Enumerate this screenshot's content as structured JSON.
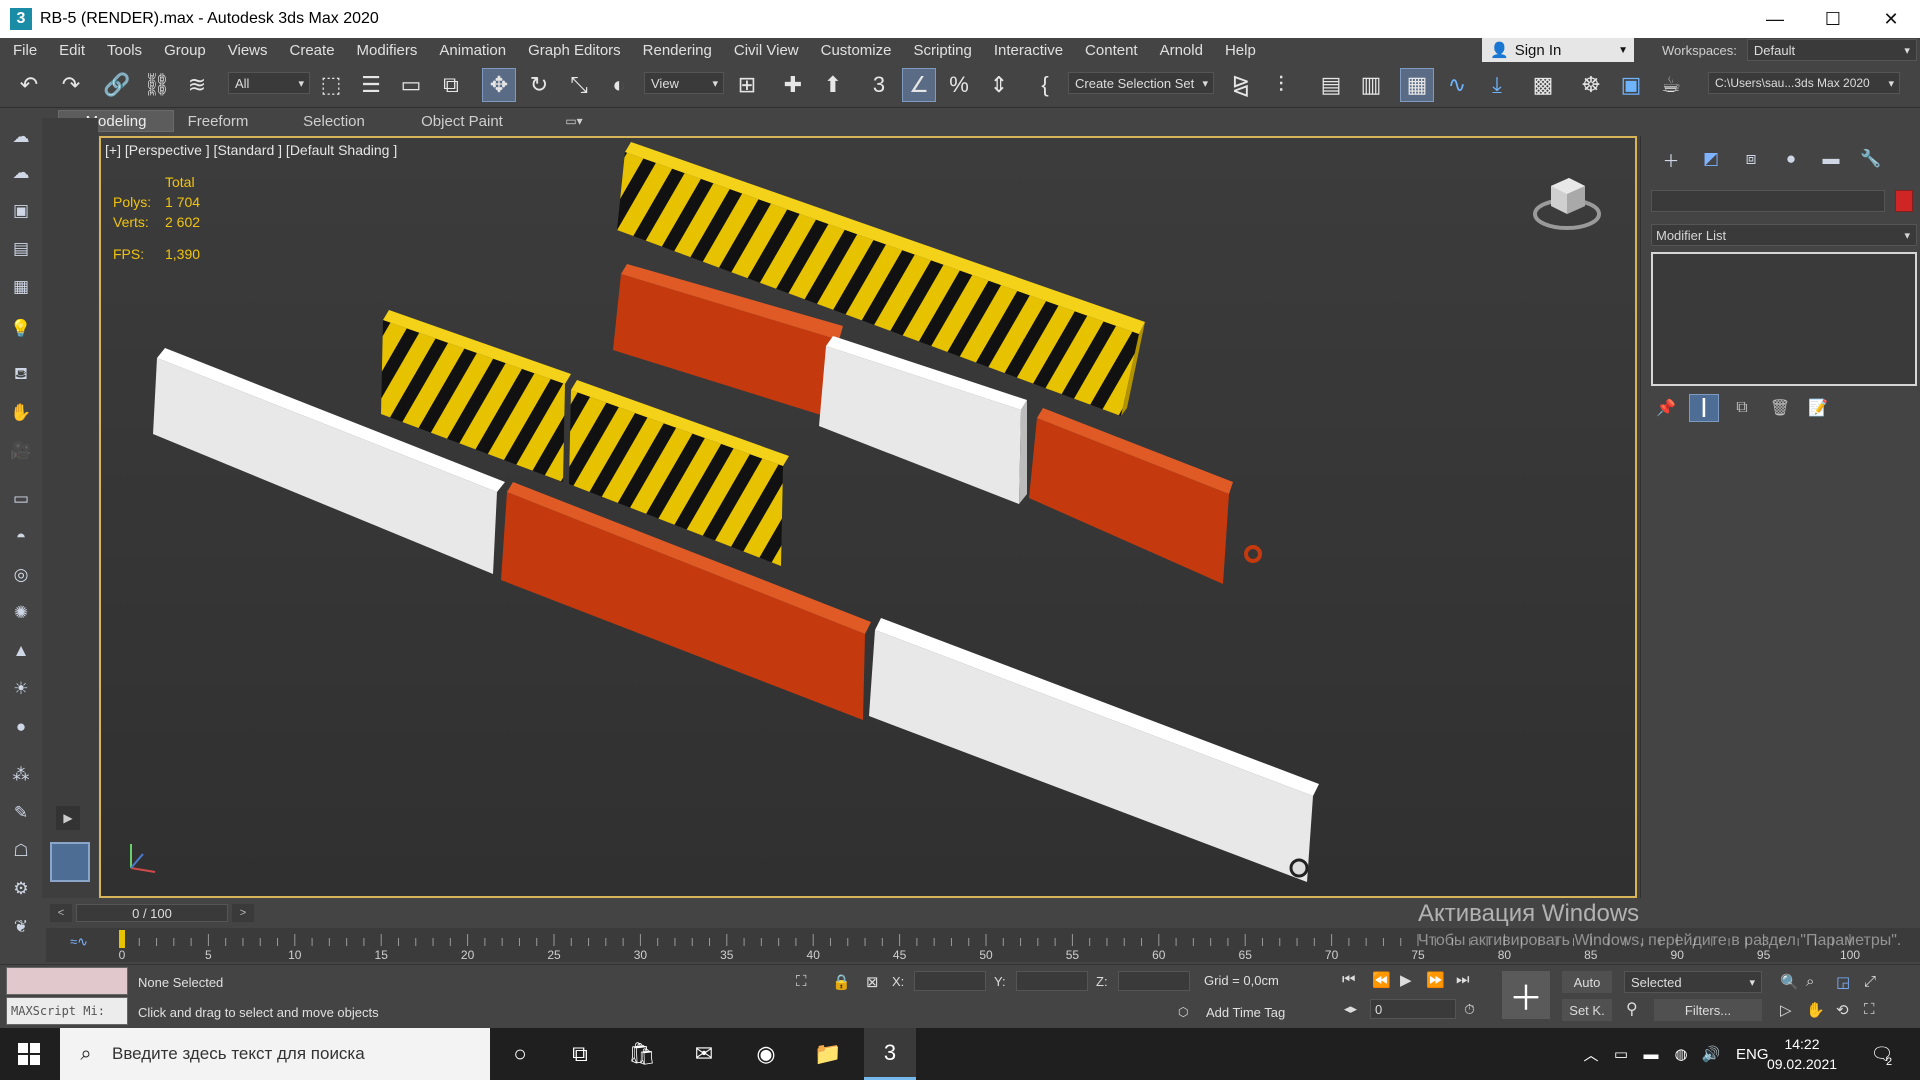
{
  "window": {
    "icon_label": "3",
    "title": "RB-5 (RENDER).max - Autodesk 3ds Max 2020",
    "minimize": "—",
    "maximize": "☐",
    "close": "✕"
  },
  "menu": [
    "File",
    "Edit",
    "Tools",
    "Group",
    "Views",
    "Create",
    "Modifiers",
    "Animation",
    "Graph Editors",
    "Rendering",
    "Civil View",
    "Customize",
    "Scripting",
    "Interactive",
    "Content",
    "Arnold",
    "Help"
  ],
  "signin": {
    "label": "Sign In"
  },
  "workspaces": {
    "label": "Workspaces:",
    "value": "Default"
  },
  "toolbar": {
    "filter_value": "All",
    "view_value": "View",
    "selection_set": "Create Selection Set",
    "project_path": "C:\\Users\\sau...3ds Max 2020"
  },
  "ribbon_tabs": [
    "Modeling",
    "Freeform",
    "Selection",
    "Object Paint"
  ],
  "viewport": {
    "label": "[+] [Perspective ] [Standard ] [Default Shading ]",
    "stats": {
      "header": "Total",
      "polys_label": "Polys:",
      "polys_value": "1 704",
      "verts_label": "Verts:",
      "verts_value": "2 602",
      "fps_label": "FPS:",
      "fps_value": "1,390"
    },
    "barrier_colors": {
      "yellow": "#e6c200",
      "black": "#111111",
      "orange": "#c43a0e",
      "white": "#e8e8e8"
    }
  },
  "command_panel": {
    "modifier_list": "Modifier List",
    "object_color": "#d02525"
  },
  "timeslider": {
    "value": "0 / 100",
    "prev": "<",
    "next": ">"
  },
  "trackbar": {
    "ticks": [
      "0",
      "5",
      "10",
      "15",
      "20",
      "25",
      "30",
      "35",
      "40",
      "45",
      "50",
      "55",
      "60",
      "65",
      "70",
      "75",
      "80",
      "85",
      "90",
      "95",
      "100"
    ]
  },
  "status": {
    "maxscript": "MAXScript Mi:",
    "selection": "None Selected",
    "prompt": "Click and drag to select and move objects",
    "x_label": "X:",
    "y_label": "Y:",
    "z_label": "Z:",
    "grid": "Grid = 0,0cm",
    "add_time_tag": "Add Time Tag",
    "frame": "0",
    "auto": "Auto",
    "setk": "Set K.",
    "selected": "Selected",
    "filters": "Filters..."
  },
  "activation": {
    "title": "Активация Windows",
    "subtitle": "Чтобы активировать Windows, перейдите в раздел \"Параметры\"."
  },
  "taskbar": {
    "search_placeholder": "Введите здесь текст для поиска",
    "lang": "ENG",
    "time": "14:22",
    "date": "09.02.2021",
    "notif_count": "2"
  }
}
